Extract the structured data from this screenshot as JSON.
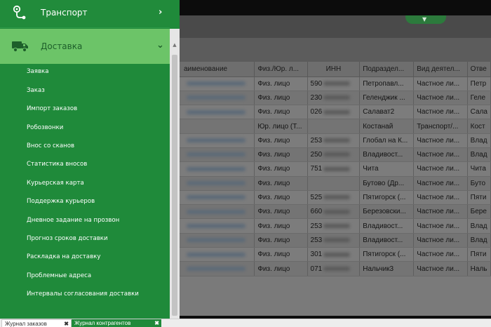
{
  "menu": {
    "transport_label": "Транспорт",
    "delivery_label": "Доставка",
    "items": [
      "Заявка",
      "Заказ",
      "Импорт заказов",
      "Робозвонки",
      "Внос со сканов",
      "Статистика вносов",
      "Курьерская карта",
      "Поддержка курьеров",
      "Дневное задание на прозвон",
      "Прогноз сроков доставки",
      "Раскладка на доставку",
      "Проблемные адреса",
      "Интервалы согласования доставки"
    ]
  },
  "table": {
    "headers": [
      "аименование",
      "Физ./Юр. л...",
      "ИНН",
      "Подраздел...",
      "Вид деятел...",
      "Отве"
    ],
    "rows": [
      {
        "name_blurred": true,
        "type": "Физ. лицо",
        "inn": "590",
        "sub": "Петропавл...",
        "act": "Частное ли...",
        "resp": "Петр"
      },
      {
        "name_blurred": true,
        "type": "Физ. лицо",
        "inn": "230",
        "sub": "Геленджик ...",
        "act": "Частное ли...",
        "resp": "Геле"
      },
      {
        "name_blurred": true,
        "type": "Физ. лицо",
        "inn": "026",
        "sub": "Салават2",
        "act": "Частное ли...",
        "resp": "Сала"
      },
      {
        "name_blurred": false,
        "type": "Юр. лицо (Т...",
        "inn": "",
        "sub": "Костанай",
        "act": "Транспорт/...",
        "resp": "Кост"
      },
      {
        "name_blurred": true,
        "type": "Физ. лицо",
        "inn": "253",
        "sub": "Глобал на К...",
        "act": "Частное ли...",
        "resp": "Влад"
      },
      {
        "name_blurred": true,
        "type": "Физ. лицо",
        "inn": "250",
        "sub": "Владивост...",
        "act": "Частное ли...",
        "resp": "Влад"
      },
      {
        "name_blurred": true,
        "type": "Физ. лицо",
        "inn": "751",
        "sub": "Чита",
        "act": "Частное ли...",
        "resp": "Чита"
      },
      {
        "name_blurred": true,
        "type": "Физ. лицо",
        "inn": "",
        "sub": "Бутово (Др...",
        "act": "Частное ли...",
        "resp": "Буто"
      },
      {
        "name_blurred": true,
        "type": "Физ. лицо",
        "inn": "525",
        "sub": "Пятигорск (...",
        "act": "Частное ли...",
        "resp": "Пяти"
      },
      {
        "name_blurred": true,
        "type": "Физ. лицо",
        "inn": "660",
        "sub": "Березовски...",
        "act": "Частное ли...",
        "resp": "Бере"
      },
      {
        "name_blurred": true,
        "type": "Физ. лицо",
        "inn": "253",
        "sub": "Владивост...",
        "act": "Частное ли...",
        "resp": "Влад"
      },
      {
        "name_blurred": true,
        "type": "Физ. лицо",
        "inn": "253",
        "sub": "Владивост...",
        "act": "Частное ли...",
        "resp": "Влад"
      },
      {
        "name_blurred": true,
        "type": "Физ. лицо",
        "inn": "301",
        "sub": "Пятигорск (...",
        "act": "Частное ли...",
        "resp": "Пяти"
      },
      {
        "name_blurred": true,
        "type": "Физ. лицо",
        "inn": "071",
        "sub": "Нальчик3",
        "act": "Частное ли...",
        "resp": "Наль"
      }
    ]
  },
  "tabs": [
    {
      "label": "Журнал заказов",
      "active": false
    },
    {
      "label": "Журнал контрагентов",
      "active": true
    }
  ],
  "colors": {
    "menu_green": "#1f8a3a",
    "menu_active": "#6cc468",
    "overlay_dim": "#7a7a7a"
  },
  "icons": {
    "transport": "route-pin-icon",
    "delivery": "truck-icon",
    "collapse": "chevron-down-icon",
    "expand": "chevron-right-icon"
  }
}
